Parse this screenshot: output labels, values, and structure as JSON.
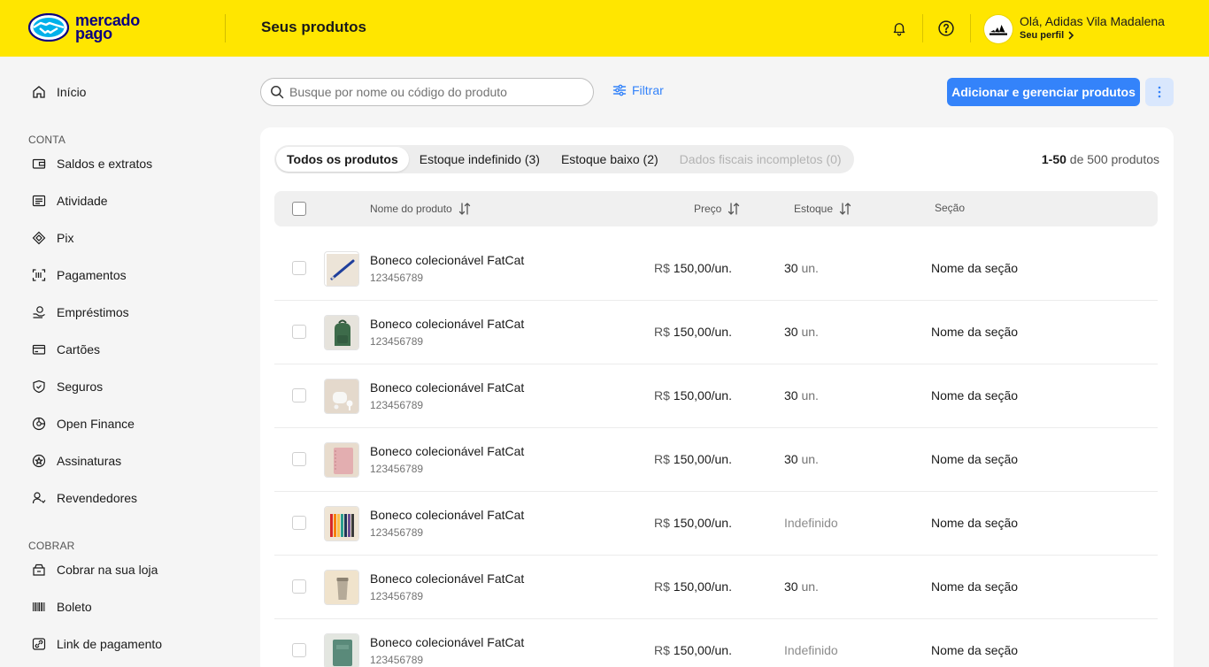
{
  "brand": {
    "line1": "mercado",
    "line2": "pago",
    "color": "#0a0080",
    "header_color": "#ffe600"
  },
  "header": {
    "title": "Seus produtos",
    "greeting": "Olá, Adidas Vila Madalena",
    "profile_link": "Seu perfil"
  },
  "sidebar": {
    "home": {
      "label": "Início",
      "icon": "home-icon"
    },
    "section_account": "CONTA",
    "account_items": [
      {
        "label": "Saldos e extratos",
        "icon": "wallet-icon"
      },
      {
        "label": "Atividade",
        "icon": "list-icon"
      },
      {
        "label": "Pix",
        "icon": "pix-icon"
      },
      {
        "label": "Pagamentos",
        "icon": "qr-scan-icon"
      },
      {
        "label": "Empréstimos",
        "icon": "loan-icon"
      },
      {
        "label": "Cartões",
        "icon": "card-icon"
      },
      {
        "label": "Seguros",
        "icon": "shield-icon"
      },
      {
        "label": "Open Finance",
        "icon": "open-finance-icon"
      },
      {
        "label": "Assinaturas",
        "icon": "subscription-icon"
      },
      {
        "label": "Revendedores",
        "icon": "reseller-icon"
      }
    ],
    "section_charge": "COBRAR",
    "charge_items": [
      {
        "label": "Cobrar na sua loja",
        "icon": "store-icon"
      },
      {
        "label": "Boleto",
        "icon": "barcode-icon"
      },
      {
        "label": "Link de pagamento",
        "icon": "link-icon"
      }
    ]
  },
  "toolbar": {
    "search_placeholder": "Busque por nome ou código do produto",
    "filter_label": "Filtrar",
    "primary_label": "Adicionar e gerenciar produtos"
  },
  "tabs": [
    {
      "label": "Todos os produtos",
      "state": "active"
    },
    {
      "label": "Estoque indefinido (3)",
      "state": "normal"
    },
    {
      "label": "Estoque baixo (2)",
      "state": "normal"
    },
    {
      "label": "Dados fiscais incompletos (0)",
      "state": "disabled"
    }
  ],
  "pagination": {
    "range": "1-50",
    "text": "de 500 produtos"
  },
  "table": {
    "columns": {
      "name": "Nome do produto",
      "price": "Preço",
      "stock": "Estoque",
      "section": "Seção"
    },
    "rows": [
      {
        "name": "Boneco colecionável FatCat",
        "code": "123456789",
        "currency": "R$",
        "price": "150,00/un.",
        "stock_qty": "30",
        "stock_unit": "un.",
        "stock_text": "",
        "section": "Nome da seção",
        "thumb": "pen",
        "thumb_bg": "#ece4d8"
      },
      {
        "name": "Boneco colecionável FatCat",
        "code": "123456789",
        "currency": "R$",
        "price": "150,00/un.",
        "stock_qty": "30",
        "stock_unit": "un.",
        "stock_text": "",
        "section": "Nome da seção",
        "thumb": "backpack",
        "thumb_bg": "#e6e3dc"
      },
      {
        "name": "Boneco colecionável FatCat",
        "code": "123456789",
        "currency": "R$",
        "price": "150,00/un.",
        "stock_qty": "30",
        "stock_unit": "un.",
        "stock_text": "",
        "section": "Nome da seção",
        "thumb": "earbuds",
        "thumb_bg": "#e4d9cc"
      },
      {
        "name": "Boneco colecionável FatCat",
        "code": "123456789",
        "currency": "R$",
        "price": "150,00/un.",
        "stock_qty": "30",
        "stock_unit": "un.",
        "stock_text": "",
        "section": "Nome da seção",
        "thumb": "notebook",
        "thumb_bg": "#e8dccd"
      },
      {
        "name": "Boneco colecionável FatCat",
        "code": "123456789",
        "currency": "R$",
        "price": "150,00/un.",
        "stock_qty": "",
        "stock_unit": "",
        "stock_text": "Indefinido",
        "section": "Nome da seção",
        "thumb": "pencils",
        "thumb_bg": "#efe5d5"
      },
      {
        "name": "Boneco colecionável FatCat",
        "code": "123456789",
        "currency": "R$",
        "price": "150,00/un.",
        "stock_qty": "30",
        "stock_unit": "un.",
        "stock_text": "",
        "section": "Nome da seção",
        "thumb": "tumbler",
        "thumb_bg": "#f0e3cc"
      },
      {
        "name": "Boneco colecionável FatCat",
        "code": "123456789",
        "currency": "R$",
        "price": "150,00/un.",
        "stock_qty": "",
        "stock_unit": "",
        "stock_text": "Indefinido",
        "section": "Nome da seção",
        "thumb": "journal",
        "thumb_bg": "#e3e6e0"
      }
    ]
  }
}
